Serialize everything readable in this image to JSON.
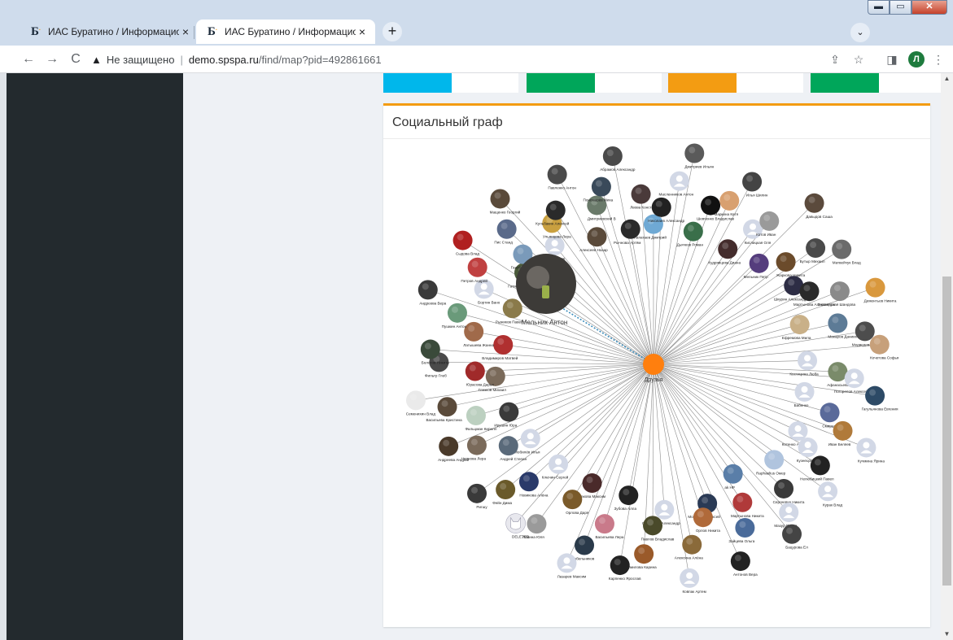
{
  "browser": {
    "tabs": [
      {
        "favicon": "Б",
        "title": "ИАС Буратино / Информацион",
        "close": "×",
        "active": false
      },
      {
        "favicon": "Б",
        "title": "ИАС Буратино / Информацион",
        "close": "×",
        "active": true
      }
    ],
    "new_tab": "+",
    "window_controls": {
      "minimize": "▬",
      "maximize": "▭",
      "close": "✕"
    },
    "security_icon": "▲",
    "security_text": "Не защищено",
    "url_host": "demo.spspa.ru",
    "url_path": "/find/map?pid=492861661",
    "profile_initial": "Л"
  },
  "stats_colors": [
    "#00b7eb",
    "#00a65a",
    "#f39c12",
    "#00a65a"
  ],
  "card": {
    "title": "Социальный граф",
    "accent": "#f39c12"
  },
  "graph": {
    "center": {
      "label": "Друзья",
      "color": "#ff7f0e"
    },
    "main_person": {
      "label": "Мельник Антон"
    },
    "leaves": [
      {
        "label": "Лапатаев Дмитрий",
        "avatar": "#6fa9d4"
      },
      {
        "label": "Николаев Александр",
        "avatar": "#222"
      },
      {
        "label": "Масленников Антон",
        "avatar": "placeholder"
      },
      {
        "label": "Дмитриев Ильян",
        "avatar": "#5a5a5a"
      },
      {
        "label": "Дьячков Роман",
        "avatar": "#3a6f4a"
      },
      {
        "label": "Шевченко Владислав",
        "avatar": "#111"
      },
      {
        "label": "Маркина Катя",
        "avatar": "#d8a070"
      },
      {
        "label": "Илья Шилин",
        "avatar": "#444"
      },
      {
        "label": "Кудрявцева Диана",
        "avatar": "#442c2c"
      },
      {
        "label": "Кислицкая Оля",
        "avatar": "placeholder"
      },
      {
        "label": "Котов Иван",
        "avatar": "#9a9a9a"
      },
      {
        "label": "Давыдов Саша",
        "avatar": "#5b4a3c"
      },
      {
        "label": "Мельник Петр",
        "avatar": "#553d7d"
      },
      {
        "label": "Жаркова Никита",
        "avatar": "#6b4b2b"
      },
      {
        "label": "Бутыр Михаил",
        "avatar": "#4a4a4a"
      },
      {
        "label": "Матвейчук Влад",
        "avatar": "#6b6b6b"
      },
      {
        "label": "Шкурин Александр",
        "avatar": "#2d2d45"
      },
      {
        "label": "Мартынова Александра",
        "avatar": "#2a2a2a"
      },
      {
        "label": "Знаменская Шандова",
        "avatar": "#8a8a8a"
      },
      {
        "label": "Дементьев Никита",
        "avatar": "#d9983d"
      },
      {
        "label": "Ефремова Мила",
        "avatar": "#c9b088"
      },
      {
        "label": "Макаров Даниил",
        "avatar": "#5d7b96"
      },
      {
        "label": "Медведева",
        "avatar": "#4d4d4d"
      },
      {
        "label": "Кочетова Софья",
        "avatar": "#c7a07a"
      },
      {
        "label": "Костицина Люба",
        "avatar": "placeholder"
      },
      {
        "label": "Афанасьева Лиза",
        "avatar": "#7a8b6a"
      },
      {
        "label": "Погорелов Алексей",
        "avatar": "placeholder"
      },
      {
        "label": "Гагульянова Евгения",
        "avatar": "#2d4a66"
      },
      {
        "label": "Бабенко",
        "avatar": "placeholder"
      },
      {
        "label": "Смирнов Глеб",
        "avatar": "#5a6a9a"
      },
      {
        "label": "Иван Беляев",
        "avatar": "#b07a3a"
      },
      {
        "label": "Кучмина Ярина",
        "avatar": "placeholder"
      },
      {
        "label": "Котенко Алина",
        "avatar": "placeholder"
      },
      {
        "label": "Кузнецова Полина",
        "avatar": "placeholder"
      },
      {
        "label": "Нелюбицкий Павел",
        "avatar": "#222"
      },
      {
        "label": "Курак Влад",
        "avatar": "placeholder"
      },
      {
        "label": "Raphaelius Омер",
        "avatar": "#b0c4de"
      },
      {
        "label": "Сергеевич Никита",
        "avatar": "#3a3a3a"
      },
      {
        "label": "Мазур Павел",
        "avatar": "placeholder"
      },
      {
        "label": "Бацурова Ел",
        "avatar": "#444"
      },
      {
        "label": "ak HP",
        "avatar": "#5a7ea8"
      },
      {
        "label": "Мартынова Никита",
        "avatar": "#b03a3a"
      },
      {
        "label": "Зайцева Ольга",
        "avatar": "#4a6b9a"
      },
      {
        "label": "Антонов Вера",
        "avatar": "#222"
      },
      {
        "label": "Моргачев Алексей",
        "avatar": "#2a3a55"
      },
      {
        "label": "Орлов Никита",
        "avatar": "#b06a3a"
      },
      {
        "label": "Алексина Алёна",
        "avatar": "#8a6a3a"
      },
      {
        "label": "Ковпак Артем",
        "avatar": "placeholder"
      },
      {
        "label": "Сергеевич Александр",
        "avatar": "placeholder"
      },
      {
        "label": "Павлов Владислав",
        "avatar": "#4a4a2a"
      },
      {
        "label": "Шумилова Карина",
        "avatar": "#9a5a2a"
      },
      {
        "label": "Карпенко Ярослав",
        "avatar": "#222"
      },
      {
        "label": "Зубова Алла",
        "avatar": "#222"
      },
      {
        "label": "Васильева Лера",
        "avatar": "#c97a8a"
      },
      {
        "label": "Корабельников",
        "avatar": "#2a3a4a"
      },
      {
        "label": "Лазарев Максим",
        "avatar": "placeholder"
      },
      {
        "label": "Шестакова Максим",
        "avatar": "#4a2a2a"
      },
      {
        "label": "Орлова Даря",
        "avatar": "#7a5a2a"
      },
      {
        "label": "Лёвина Юля",
        "avatar": "#9a9a9a"
      },
      {
        "label": "DELETED",
        "avatar": "deleted"
      },
      {
        "label": "Ключин Сергей",
        "avatar": "placeholder"
      },
      {
        "label": "Новикова Алёна",
        "avatar": "#2a3a6a"
      },
      {
        "label": "Фейн Дима",
        "avatar": "#6a5a2a"
      },
      {
        "label": "Ригшу",
        "avatar": "#3a3a3a"
      },
      {
        "label": "Мобилёв Илья",
        "avatar": "placeholder"
      },
      {
        "label": "Андрей Степан",
        "avatar": "#5a6a7a"
      },
      {
        "label": "Чернова Лера",
        "avatar": "#7a6a5a"
      },
      {
        "label": "Андреева Андрей",
        "avatar": "#4a3a2a"
      },
      {
        "label": "Ирушин Юра",
        "avatar": "#3a3a3a"
      },
      {
        "label": "Фальцман Кирилл",
        "avatar": "#bcd0c0"
      },
      {
        "label": "Васильева Кристина",
        "avatar": "#5a4a3a"
      },
      {
        "label": "Семенихин Влад",
        "avatar": "#eaeaea"
      },
      {
        "label": "Глазков Михаил",
        "avatar": "#7a6a5a"
      },
      {
        "label": "Юрасова Дарья",
        "avatar": "#a02a2a"
      },
      {
        "label": "Фильтр Глеб",
        "avatar": "#4a4a4a"
      },
      {
        "label": "Болотов Никита",
        "avatar": "#3a4a3a"
      },
      {
        "label": "Владимиров Матвей",
        "avatar": "#b03030"
      },
      {
        "label": "Латышева Жанна",
        "avatar": "#a06a4a"
      },
      {
        "label": "Пушкин Антон",
        "avatar": "#6a9a7a"
      },
      {
        "label": "Андреева Вера",
        "avatar": "#3a3a3a"
      },
      {
        "label": "Рыжиков Павел",
        "avatar": "#8a7a4a"
      },
      {
        "label": "Бортин Вано",
        "avatar": "placeholder"
      },
      {
        "label": "Петров Андрей",
        "avatar": "#c04040"
      },
      {
        "label": "Сыдова Влад",
        "avatar": "#b02020"
      },
      {
        "label": "Гатиев Эдуард",
        "avatar": "#4a5a3a"
      },
      {
        "label": "Ганибек Александр",
        "avatar": "#7a9aba"
      },
      {
        "label": "Пис Станд",
        "avatar": "#5a6a8a"
      },
      {
        "label": "Мащенко Георгий",
        "avatar": "#5a4a3a"
      },
      {
        "label": "Пестопьяров Ж",
        "avatar": "placeholder"
      },
      {
        "label": "Ульянцева Лера",
        "avatar": "#c9a040"
      },
      {
        "label": "Кульбакин Алексей",
        "avatar": "#2a2a2a"
      },
      {
        "label": "Павленко Антон",
        "avatar": "#4a4a4a"
      },
      {
        "label": "Алексеев Назар",
        "avatar": "#5a4a3a"
      },
      {
        "label": "Дмитриевский В",
        "avatar": "#6a7a6a"
      },
      {
        "label": "Пономарёв Миха",
        "avatar": "#3a4a5a"
      },
      {
        "label": "Абрамов Александр",
        "avatar": "#4a4a4a"
      },
      {
        "label": "Рычнова Артём",
        "avatar": "#2a2a2a"
      },
      {
        "label": "Лвова Константин",
        "avatar": "#4a3a3a"
      }
    ]
  }
}
